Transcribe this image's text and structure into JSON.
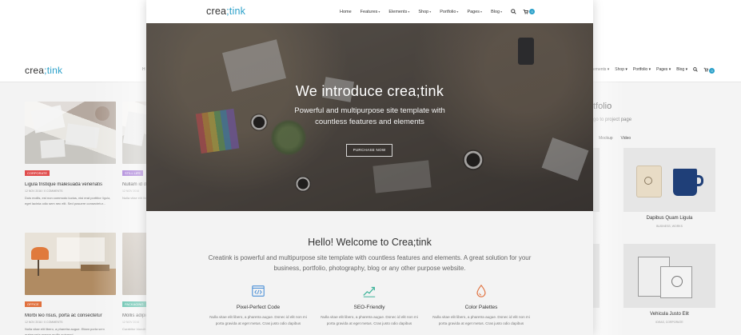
{
  "back_left": {
    "logo": "crea",
    "logo_accent": ";tink",
    "nav_fragment": "H",
    "posts": [
      {
        "tag": "CORPORATE",
        "tag_color": "#e04d4d",
        "title": "Ligula tristique malesuada venenatis",
        "meta": "12 NOV 2016  /  0 COMMENTS",
        "excerpt": "Duis mollis, est non commodo luctus, nisi erat porttitor ligula, eget lacinia odio sem nec elit. Sed posuere consectetur..."
      },
      {
        "tag": "STILL LIFE",
        "tag_color": "#9a6ad1",
        "title": "Nullam id d",
        "meta": "12 NOV 2016",
        "excerpt": "Nulla vitae elit libero, a pharetra augue. Maecenas sed diam eget risus varius blandit"
      },
      {
        "tag": "OFFICE",
        "tag_color": "#e0703d",
        "title": "Morbi leo risus, porta ac consectetur",
        "meta": "12 NOV 2016  /  0 COMMENTS",
        "excerpt": "Nulla vitae elit libero, a pharetra augue. Etiam porta sem malesuada magna mollis euismod."
      },
      {
        "tag": "PACKAGING",
        "tag_color": "#3fb39a",
        "title": "Mollis adipi",
        "meta": "12 NOV 2016",
        "excerpt": "Curabitur blandit tempus porttitor. Nullam quis risus eget urna mollis"
      }
    ]
  },
  "back_right": {
    "nav": [
      "ements ▾",
      "Shop ▾",
      "Portfolio ▾",
      "Pages ▾",
      "Blog ▾"
    ],
    "heading": "tfolio",
    "sub": "go to project page",
    "filters": [
      "Mockup",
      "Video"
    ],
    "items": [
      {
        "name": "Dapibus Quam Ligula",
        "category": "BUSINESS, WORKS"
      },
      {
        "name": "Vehicula Justo Elit",
        "category": "IDEAS, CORPORATE"
      }
    ]
  },
  "front": {
    "logo": "crea",
    "logo_accent": ";tink",
    "nav": [
      {
        "label": "Home",
        "caret": ""
      },
      {
        "label": "Features",
        "caret": "▾"
      },
      {
        "label": "Elements",
        "caret": "▾"
      },
      {
        "label": "Shop",
        "caret": "▾"
      },
      {
        "label": "Portfolio",
        "caret": "▾"
      },
      {
        "label": "Pages",
        "caret": "▾"
      },
      {
        "label": "Blog",
        "caret": "▾"
      }
    ],
    "cart_count": "0",
    "hero": {
      "title": "We introduce crea;tink",
      "subtitle": "Powerful and multipurpose site template with countless features and elements",
      "button": "PURCHASE NOW"
    },
    "welcome": {
      "title": "Hello! Welcome to Crea;tink",
      "text": "Creatink is powerful and multipurpose site template with countless features and elements. A great solution for your business, portfolio, photography, blog or any other purpose website."
    },
    "features": [
      {
        "icon": "code-icon",
        "name": "Pixel-Perfect Code",
        "desc": "Nulla vitae elit libero, a pharetra augue. Donec id elit non mi porta gravida at eget metus. Cras justo odio dapibus"
      },
      {
        "icon": "seo-icon",
        "name": "SEO-Friendly",
        "desc": "Nulla vitae elit libero, a pharetra augue. Donec id elit non mi porta gravida at eget metus. Cras justo odio dapibus"
      },
      {
        "icon": "drop-icon",
        "name": "Color Palettes",
        "desc": "Nulla vitae elit libero, a pharetra augue. Donec id elit non mi porta gravida at eget metus. Cras justo odio dapibus"
      }
    ],
    "colors": {
      "accent": "#2aa0c9",
      "icon_blue": "#4a8fd6",
      "icon_green": "#3fb39a",
      "icon_orange": "#e0703d"
    }
  }
}
